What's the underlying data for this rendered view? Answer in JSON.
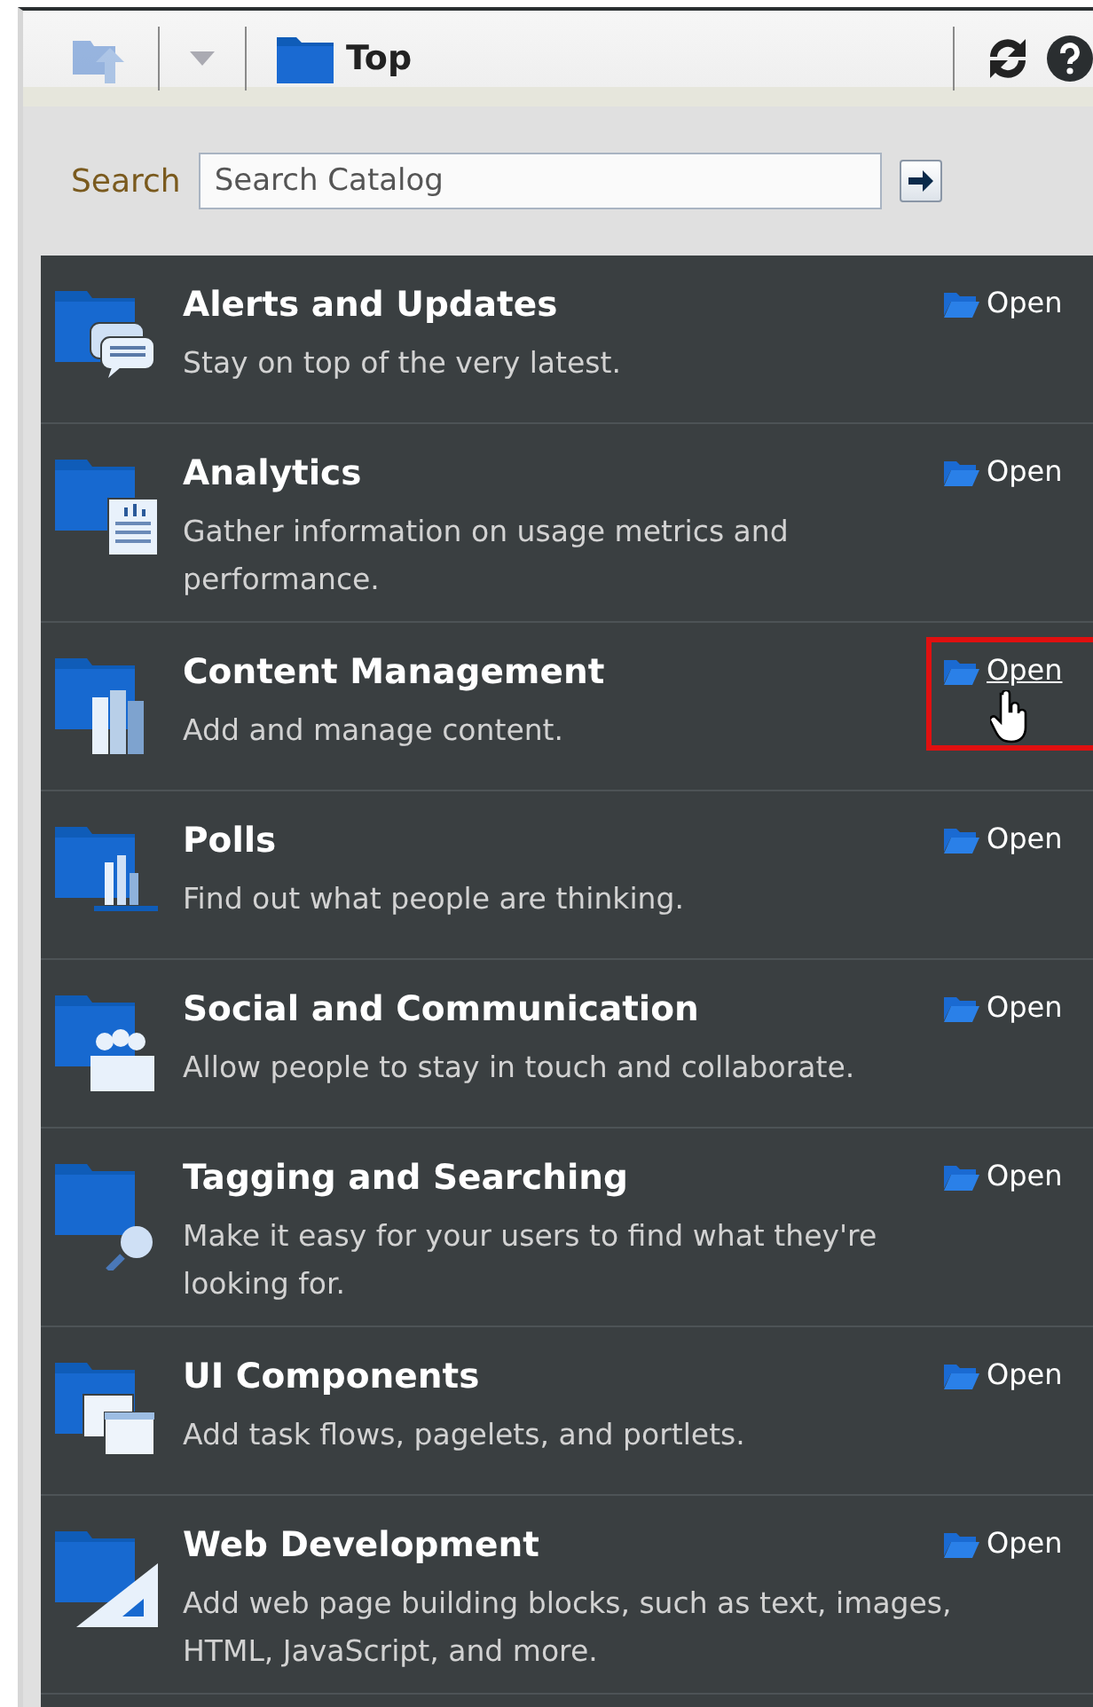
{
  "toolbar": {
    "location": "Top",
    "up_disabled": true
  },
  "search": {
    "label": "Search",
    "placeholder": "Search Catalog"
  },
  "items": [
    {
      "title": "Alerts and Updates",
      "lines": [
        "Stay on top of the very latest."
      ],
      "action": "Open",
      "highlighted": false
    },
    {
      "title": "Analytics",
      "lines": [
        "Gather information on usage metrics and",
        "performance."
      ],
      "action": "Open",
      "highlighted": false
    },
    {
      "title": "Content Management",
      "lines": [
        "Add and manage content."
      ],
      "action": "Open",
      "highlighted": true
    },
    {
      "title": "Polls",
      "lines": [
        "Find out what people are thinking."
      ],
      "action": "Open",
      "highlighted": false
    },
    {
      "title": "Social and Communication",
      "lines": [
        "Allow people to stay in touch and collaborate."
      ],
      "action": "Open",
      "highlighted": false
    },
    {
      "title": "Tagging and Searching",
      "lines": [
        "Make it easy for your users to find what they're",
        "looking for."
      ],
      "action": "Open",
      "highlighted": false
    },
    {
      "title": "UI Components",
      "lines": [
        "Add task flows, pagelets, and portlets."
      ],
      "action": "Open",
      "highlighted": false
    },
    {
      "title": "Web Development",
      "lines": [
        "Add web page building blocks, such as text, images,",
        "HTML, JavaScript, and more."
      ],
      "action": "Open",
      "highlighted": false
    }
  ]
}
